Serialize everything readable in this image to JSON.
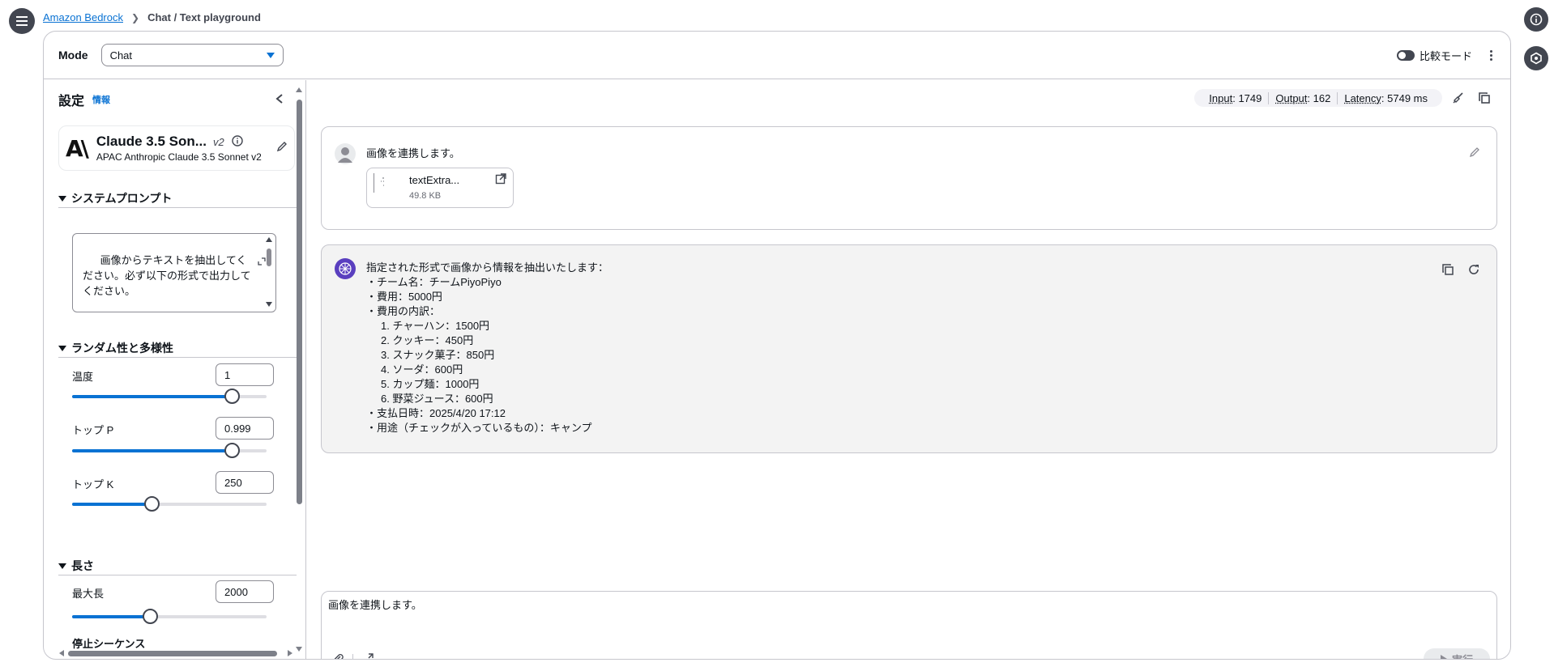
{
  "breadcrumb": {
    "root": "Amazon Bedrock",
    "current": "Chat / Text playground"
  },
  "mode_bar": {
    "label": "Mode",
    "selected": "Chat",
    "compare_label": "比較モード"
  },
  "sidebar": {
    "title": "設定",
    "info": "情報",
    "model": {
      "name": "Claude 3.5 Son...",
      "version": "v2",
      "subtitle": "APAC Anthropic Claude 3.5 Sonnet v2",
      "logo": "A\\"
    },
    "system_prompt": {
      "heading": "システムプロンプト",
      "text": "画像からテキストを抽出してください。必ず以下の形式で出力してください。\n\n・チーム名：\n・費用："
    },
    "randomness": {
      "heading": "ランダム性と多様性",
      "temperature": {
        "label": "温度",
        "value": "1",
        "fraction": 1.0
      },
      "top_p": {
        "label": "トップ P",
        "value": "0.999",
        "fraction": 0.999
      },
      "top_k": {
        "label": "トップ K",
        "value": "250",
        "fraction": 0.5
      }
    },
    "length": {
      "heading": "長さ",
      "max_length": {
        "label": "最大長",
        "value": "2000",
        "fraction": 0.49
      },
      "stop_sequences_label": "停止シーケンス"
    }
  },
  "metrics": {
    "input_label": "Input",
    "input_value": "1749",
    "output_label": "Output",
    "output_value": "162",
    "latency_label": "Latency",
    "latency_value": "5749 ms"
  },
  "user_message": {
    "text": "画像を連携します。",
    "attachment": {
      "name": "textExtra...",
      "size": "49.8 KB"
    }
  },
  "assistant_message": {
    "lines": [
      "指定された形式で画像から情報を抽出いたします：",
      "・チーム名：チームPiyoPiyo",
      "・費用：5000円",
      "・費用の内訳：",
      "     1. チャーハン：1500円",
      "     2. クッキー：450円",
      "     3. スナック菓子：850円",
      "     4. ソーダ：600円",
      "     5. カップ麺：1000円",
      "     6. 野菜ジュース：600円",
      "・支払日時：2025/4/20 17:12",
      "・用途（チェックが入っているもの）：キャンプ"
    ]
  },
  "prompt": {
    "text": "画像を連携します。",
    "run_label": "実行"
  },
  "colors": {
    "accent": "#0972d3",
    "border": "#c6c6cd",
    "ai_bg": "#f3f3f3",
    "dark": "#424650"
  }
}
